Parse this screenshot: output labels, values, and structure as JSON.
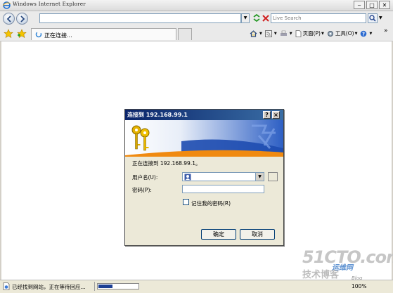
{
  "browser": {
    "title": "Windows Internet Explorer",
    "address_value": "",
    "search_placeholder": "Live Search",
    "tab_label": "正在连接...",
    "toolbar": {
      "page_label": "页面(P)",
      "tools_label": "工具(O)"
    },
    "status": {
      "text": "已经找到网站，正在等待回应...",
      "progress": 0.35,
      "zoom": "100%"
    }
  },
  "dialog": {
    "title": "连接到 192.168.99.1",
    "help_label": "?",
    "close_label": "×",
    "connecting_text": "正在连接到 192.168.99.1。",
    "username_label": "用户名(U):",
    "username_value": "",
    "password_label": "密码(P):",
    "remember_label": "记住我的密码(R)",
    "remember_checked": false,
    "ok_label": "确定",
    "cancel_label": "取消"
  },
  "watermark": {
    "site": "51CTO.com",
    "tagline": "技术博客",
    "blog": "运维网",
    "blog_sub": "Blog"
  },
  "colors": {
    "dialog_title": "#0a246a",
    "banner": "#3a6ea5",
    "progress_fill": "#1c3f94"
  }
}
